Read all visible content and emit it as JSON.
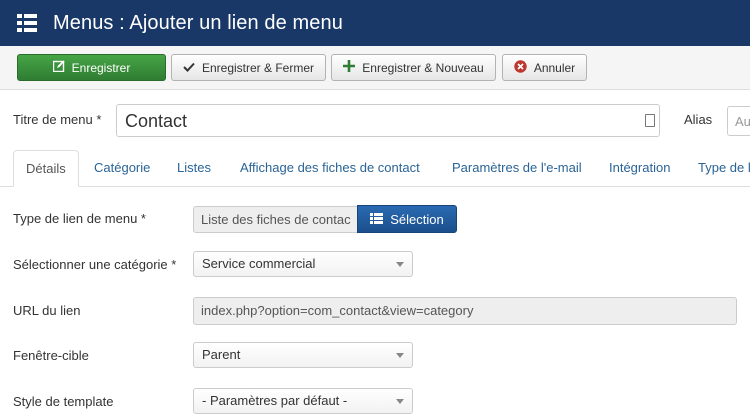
{
  "header": {
    "title": "Menus : Ajouter un lien de menu",
    "bg_color": "#1a3867"
  },
  "toolbar": {
    "save_label": "Enregistrer",
    "save_close_label": "Enregistrer & Fermer",
    "save_new_label": "Enregistrer & Nouveau",
    "cancel_label": "Annuler"
  },
  "form": {
    "title_label": "Titre de menu *",
    "title_value": "Contact",
    "alias_label": "Alias",
    "alias_placeholder": "Au"
  },
  "tabs": [
    "Détails",
    "Catégorie",
    "Listes",
    "Affichage des fiches de contact",
    "Paramètres de l'e-mail",
    "Intégration",
    "Type de l"
  ],
  "details": {
    "menu_type_label": "Type de lien de menu *",
    "menu_type_value": "Liste des fiches de contac",
    "select_button_label": "Sélection",
    "category_label": "Sélectionner une catégorie *",
    "category_value": "Service commercial",
    "url_label": "URL du lien",
    "url_value": "index.php?option=com_contact&view=category",
    "target_label": "Fenêtre-cible",
    "target_value": "Parent",
    "template_label": "Style de template",
    "template_value": "- Paramètres par défaut -"
  }
}
